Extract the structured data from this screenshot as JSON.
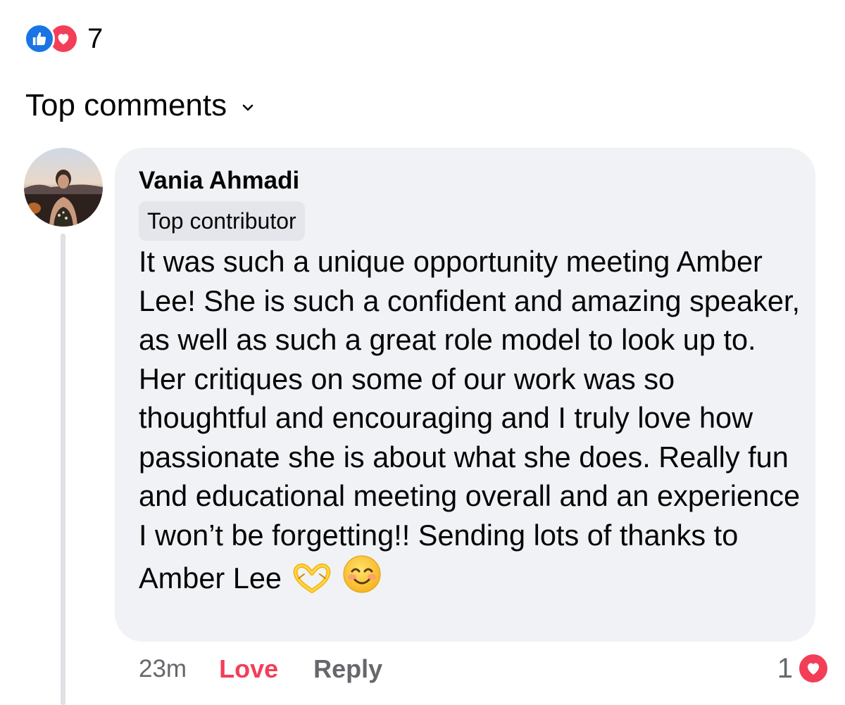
{
  "reactions": {
    "count": "7",
    "types": [
      "like-icon",
      "love-icon"
    ],
    "colors": {
      "like": "#1b74e4",
      "love": "#f33e58"
    }
  },
  "comments_section": {
    "title": "Top comments"
  },
  "comment": {
    "author": "Vania Ahmadi",
    "badge": "Top contributor",
    "text": "It was such a unique opportunity meeting Amber Lee! She is such a confident and amazing speaker, as well as such a great role model to look up to. Her critiques on some of our work was so thoughtful and encouraging and I truly love how passionate she is about what she does. Really fun and educational meeting overall and an experience I won’t be forgetting!! Sending lots of thanks to Amber Lee",
    "emojis": [
      "heart-hands-emoji",
      "smiling-face-emoji"
    ],
    "time": "23m",
    "love_label": "Love",
    "reply_label": "Reply",
    "reaction_count": "1",
    "bubble_color": "#f0f2f5"
  }
}
